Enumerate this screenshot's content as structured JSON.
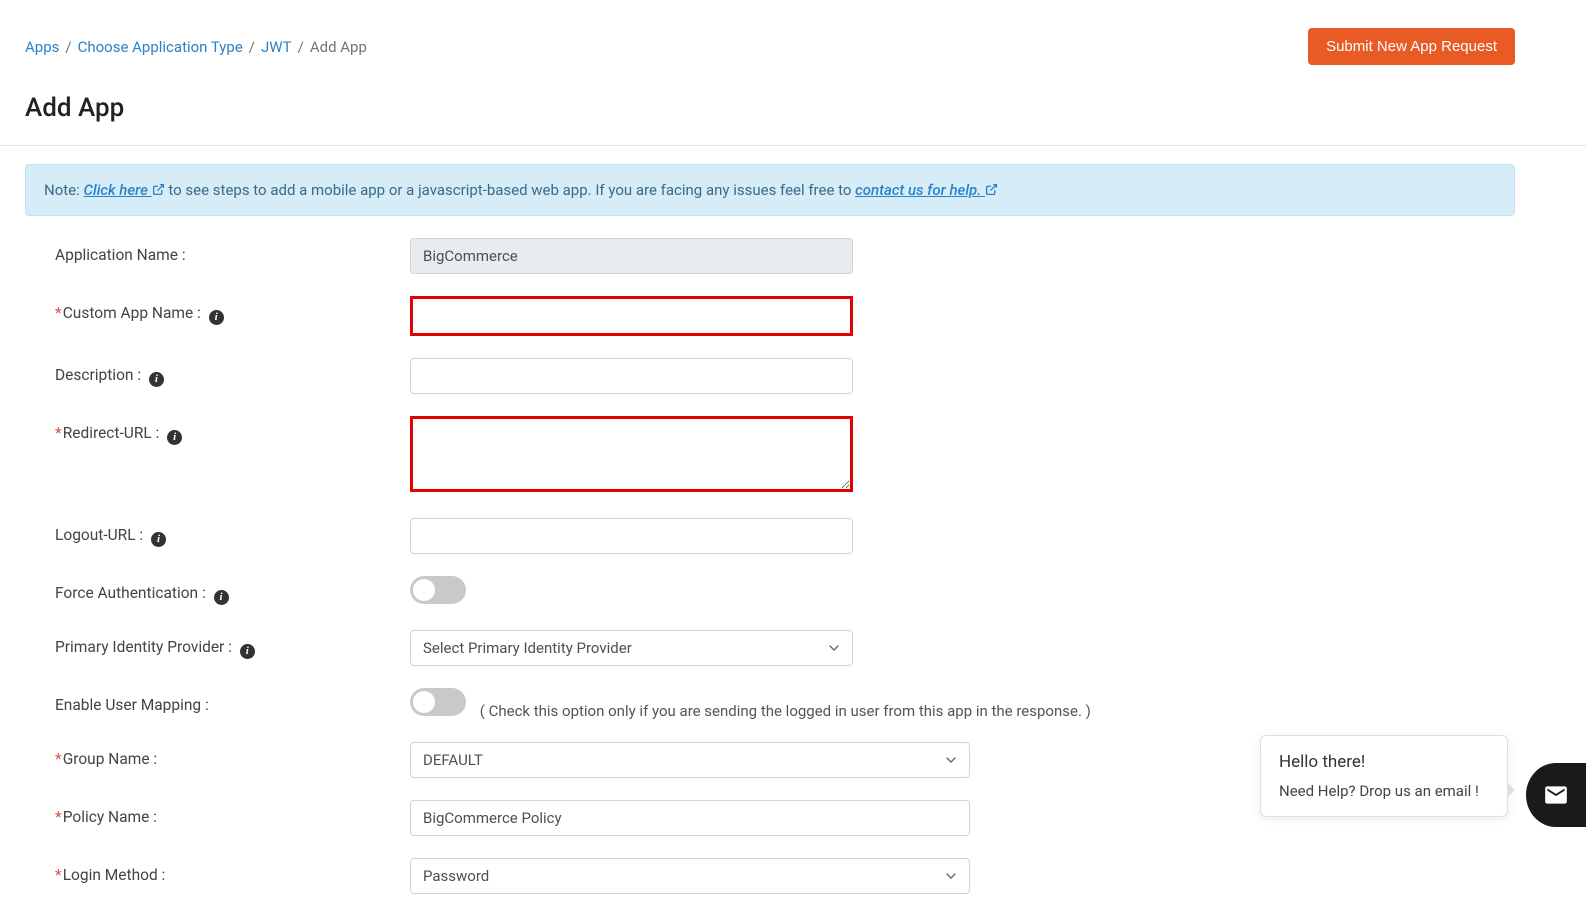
{
  "breadcrumb": {
    "items": [
      "Apps",
      "Choose Application Type",
      "JWT"
    ],
    "current": "Add App"
  },
  "header": {
    "submit_button": "Submit New App Request"
  },
  "page_title": "Add App",
  "note": {
    "prefix": "Note: ",
    "link1": "Click here",
    "middle": " to see steps to add a mobile app or a javascript-based web app. If you are facing any issues feel free to ",
    "link2": "contact us for help."
  },
  "form": {
    "app_name": {
      "label": "Application Name :",
      "value": "BigCommerce"
    },
    "custom_app_name": {
      "label": "Custom App Name :",
      "value": ""
    },
    "description": {
      "label": "Description :",
      "value": ""
    },
    "redirect_url": {
      "label": "Redirect-URL :",
      "value": ""
    },
    "logout_url": {
      "label": "Logout-URL :",
      "value": ""
    },
    "force_auth": {
      "label": "Force Authentication :"
    },
    "primary_idp": {
      "label": "Primary Identity Provider :",
      "placeholder": "Select Primary Identity Provider"
    },
    "user_mapping": {
      "label": "Enable User Mapping :",
      "helper": "( Check this option only if you are sending the logged in user from this app in the response. )"
    },
    "group_name": {
      "label": "Group Name :",
      "value": "DEFAULT"
    },
    "policy_name": {
      "label": "Policy Name :",
      "value": "BigCommerce Policy"
    },
    "login_method": {
      "label": "Login Method :",
      "value": "Password"
    }
  },
  "chat": {
    "line1": "Hello there!",
    "line2": "Need Help? Drop us an email !"
  }
}
